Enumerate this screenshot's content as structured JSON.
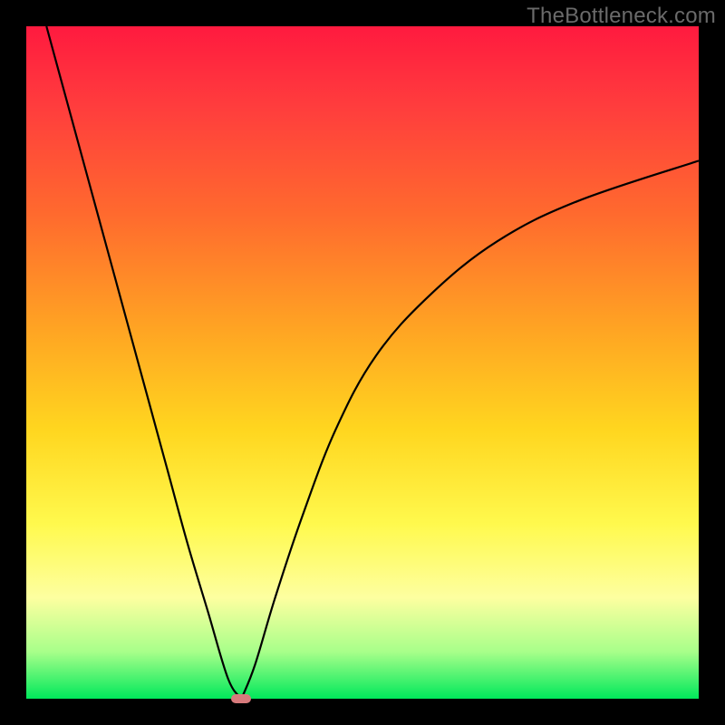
{
  "watermark": "TheBottleneck.com",
  "chart_data": {
    "type": "line",
    "title": "",
    "xlabel": "",
    "ylabel": "",
    "xlim": [
      0,
      100
    ],
    "ylim": [
      0,
      100
    ],
    "grid": false,
    "legend": false,
    "series": [
      {
        "name": "left-branch",
        "x": [
          3,
          6,
          9,
          12,
          15,
          18,
          21,
          24,
          27,
          30,
          32
        ],
        "y": [
          100,
          89,
          78,
          67,
          56,
          45,
          34,
          23,
          13,
          3,
          0
        ]
      },
      {
        "name": "right-branch",
        "x": [
          32,
          34,
          37,
          41,
          46,
          52,
          60,
          70,
          82,
          100
        ],
        "y": [
          0,
          5,
          15,
          27,
          40,
          51,
          60,
          68,
          74,
          80
        ]
      }
    ],
    "marker": {
      "x": 32,
      "y": 0,
      "color": "#d77a7c"
    },
    "gradient_stops": [
      {
        "pos": 0,
        "color": "#ff1a3f"
      },
      {
        "pos": 12,
        "color": "#ff3d3d"
      },
      {
        "pos": 28,
        "color": "#ff6a2e"
      },
      {
        "pos": 45,
        "color": "#ffa423"
      },
      {
        "pos": 60,
        "color": "#ffd61f"
      },
      {
        "pos": 74,
        "color": "#fff94d"
      },
      {
        "pos": 85,
        "color": "#fdffa0"
      },
      {
        "pos": 93,
        "color": "#a8ff8a"
      },
      {
        "pos": 100,
        "color": "#00e85b"
      }
    ]
  }
}
